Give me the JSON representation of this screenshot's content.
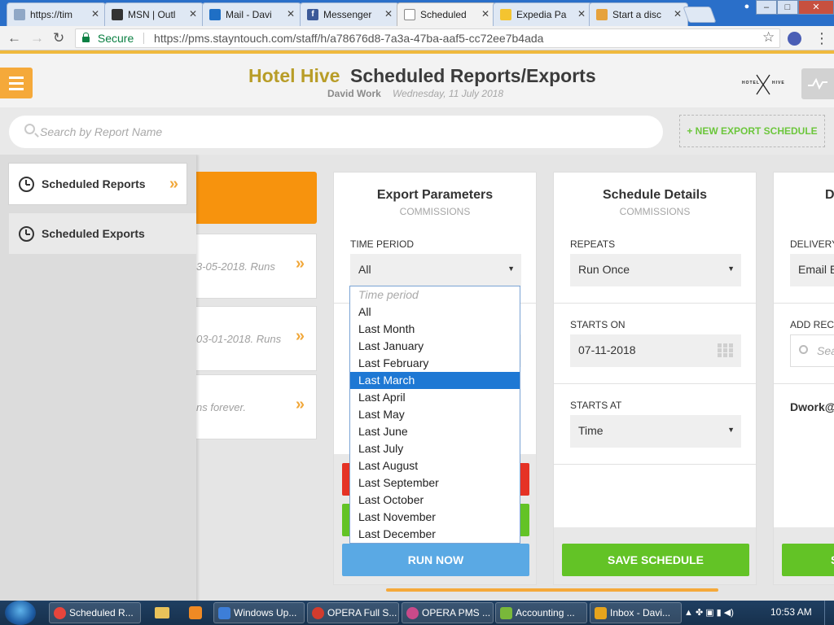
{
  "browser": {
    "tabs": [
      {
        "label": "https://tim"
      },
      {
        "label": "MSN | Outl"
      },
      {
        "label": "Mail - Davi"
      },
      {
        "label": "Messenger"
      },
      {
        "label": "Scheduled"
      },
      {
        "label": "Expedia Pa"
      },
      {
        "label": "Start a disc"
      }
    ],
    "secure_label": "Secure",
    "url": "https://pms.stayntouch.com/staff/h/a78676d8-7a3a-47ba-aaf5-cc72ee7b4ada"
  },
  "header": {
    "brand": "Hotel Hive",
    "title": "Scheduled Reports/Exports",
    "user": "David Work",
    "date": "Wednesday, 11 July 2018",
    "logo_left": "HOTEL",
    "logo_right": "HIVE"
  },
  "search": {
    "placeholder": "Search by Report Name",
    "new_export_label": "+ NEW EXPORT SCHEDULE"
  },
  "sidebar": {
    "items": [
      {
        "label": "Scheduled Reports",
        "arrow": "»"
      },
      {
        "label": "Scheduled Exports"
      }
    ]
  },
  "schedule_cards": [
    {
      "text": "3-05-2018. Runs",
      "arrow": "»"
    },
    {
      "text": "03-01-2018. Runs",
      "arrow": "»"
    },
    {
      "text": "ns forever.",
      "arrow": "»"
    }
  ],
  "export_params": {
    "title": "Export Parameters",
    "subtitle": "COMMISSIONS",
    "time_period_label": "TIME PERIOD",
    "time_period_value": "All",
    "dropdown_options": [
      "Time period",
      "All",
      "Last Month",
      "Last January",
      "Last February",
      "Last March",
      "Last April",
      "Last May",
      "Last June",
      "Last July",
      "Last August",
      "Last September",
      "Last October",
      "Last November",
      "Last December"
    ],
    "highlighted_option": "Last March",
    "run_now_label": "RUN NOW"
  },
  "schedule_details": {
    "title": "Schedule Details",
    "subtitle": "COMMISSIONS",
    "repeats_label": "REPEATS",
    "repeats_value": "Run Once",
    "starts_on_label": "STARTS ON",
    "starts_on_value": "07-11-2018",
    "starts_at_label": "STARTS AT",
    "starts_at_value": "Time",
    "save_label": "SAVE SCHEDULE"
  },
  "delivery": {
    "title": "D",
    "delivery_label": "DELIVERY",
    "delivery_value": "Email E",
    "add_recipients_label": "ADD RECI",
    "search_placeholder": "Sea",
    "recipient": "Dwork@",
    "button_label": "S"
  },
  "taskbar": {
    "items": [
      {
        "label": "Scheduled R..."
      },
      {
        "label": "Windows Up..."
      },
      {
        "label": "OPERA Full S..."
      },
      {
        "label": "OPERA PMS ..."
      },
      {
        "label": "Accounting ..."
      },
      {
        "label": "Inbox - Davi..."
      }
    ],
    "time": "10:53 AM"
  },
  "colors": {
    "accent_orange": "#f7930d",
    "brand_gold": "#b89d28",
    "green": "#63c326",
    "blue_button": "#5aa9e4",
    "highlight_blue": "#1e78d4"
  }
}
